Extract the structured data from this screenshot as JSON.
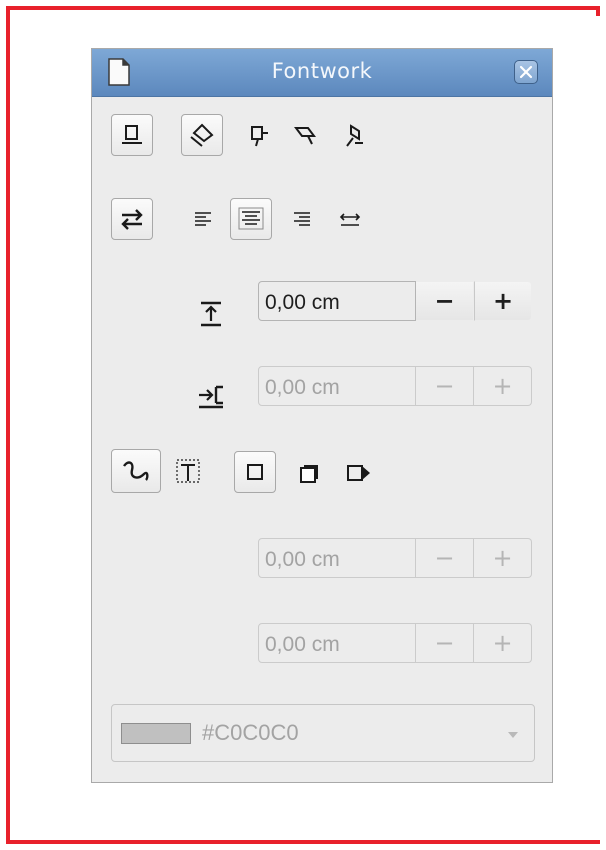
{
  "window": {
    "title": "Fontwork"
  },
  "spacing": {
    "distance": {
      "value": "0,00 cm",
      "minus": "−",
      "plus": "+"
    },
    "indent": {
      "value": "0,00 cm",
      "minus": "−",
      "plus": "+"
    }
  },
  "shadow": {
    "x": {
      "value": "0,00 cm",
      "minus": "−",
      "plus": "+"
    },
    "y": {
      "value": "0,00 cm",
      "minus": "−",
      "plus": "+"
    }
  },
  "color": {
    "label": "#C0C0C0",
    "swatch": "#C0C0C0"
  },
  "accent": {
    "titlebar": "#6f9bd0",
    "frame": "#e8212b"
  }
}
